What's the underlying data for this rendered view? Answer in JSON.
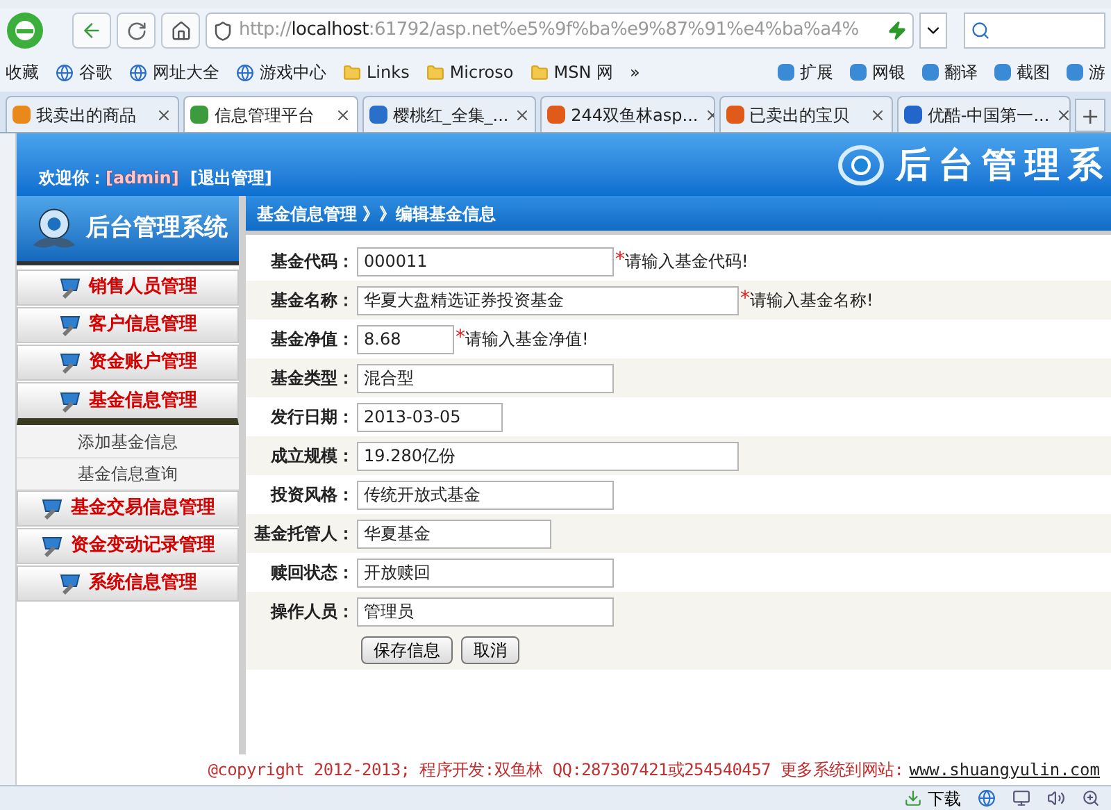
{
  "browser": {
    "url": {
      "scheme": "http://",
      "host": "localhost",
      "rest": ":61792/asp.net%e5%9f%ba%e9%87%91%e4%ba%a4%"
    },
    "bookmarks": [
      {
        "label": "收藏",
        "kind": "menu"
      },
      {
        "label": "谷歌",
        "kind": "site"
      },
      {
        "label": "网址大全",
        "kind": "site"
      },
      {
        "label": "游戏中心",
        "kind": "site"
      },
      {
        "label": "Links",
        "kind": "folder"
      },
      {
        "label": "Microso",
        "kind": "folder"
      },
      {
        "label": "MSN 网",
        "kind": "folder"
      },
      {
        "label": "»",
        "kind": "more"
      }
    ],
    "tools": [
      {
        "label": "扩展"
      },
      {
        "label": "网银"
      },
      {
        "label": "翻译"
      },
      {
        "label": "截图"
      },
      {
        "label": "游"
      }
    ],
    "tabs": [
      {
        "label": "我卖出的商品",
        "selected": false
      },
      {
        "label": "信息管理平台",
        "selected": true
      },
      {
        "label": "樱桃红_全集_...",
        "selected": false
      },
      {
        "label": "244双鱼林asp...",
        "selected": false
      },
      {
        "label": "已卖出的宝贝",
        "selected": false
      },
      {
        "label": "优酷-中国第一...",
        "selected": false
      }
    ],
    "new_tab": "+",
    "status_bar": {
      "download": "下载"
    }
  },
  "header": {
    "welcome": "欢迎你：",
    "user": "[admin]",
    "logout": "[退出管理]",
    "title": "后台管理系"
  },
  "sidebar": {
    "logo": "后台管理系统",
    "items": [
      {
        "label": "销售人员管理",
        "expanded": false
      },
      {
        "label": "客户信息管理",
        "expanded": false
      },
      {
        "label": "资金账户管理",
        "expanded": false
      },
      {
        "label": "基金信息管理",
        "expanded": true,
        "children": [
          {
            "label": "添加基金信息"
          },
          {
            "label": "基金信息查询"
          }
        ]
      },
      {
        "label": "基金交易信息管理",
        "expanded": false
      },
      {
        "label": "资金变动记录管理",
        "expanded": false
      },
      {
        "label": "系统信息管理",
        "expanded": false
      }
    ]
  },
  "breadcrumb": "基金信息管理 》》编辑基金信息",
  "form": {
    "fields": [
      {
        "label": "基金代码：",
        "value": "000011",
        "marker": "*",
        "hint": "请输入基金代码!"
      },
      {
        "label": "基金名称：",
        "value": "华夏大盘精选证券投资基金",
        "marker": "*",
        "hint": "请输入基金名称!"
      },
      {
        "label": "基金净值：",
        "value": "8.68",
        "marker": "*",
        "hint": "请输入基金净值!"
      },
      {
        "label": "基金类型：",
        "value": "混合型"
      },
      {
        "label": "发行日期：",
        "value": "2013-03-05"
      },
      {
        "label": "成立规模：",
        "value": "19.280亿份"
      },
      {
        "label": "投资风格：",
        "value": "传统开放式基金"
      },
      {
        "label": "基金托管人：",
        "value": "华夏基金"
      },
      {
        "label": "赎回状态：",
        "value": "开放赎回"
      },
      {
        "label": "操作人员：",
        "value": "管理员"
      }
    ],
    "buttons": [
      "保存信息",
      "取消"
    ]
  },
  "footer": {
    "text": "@copyright 2012-2013; 程序开发:双鱼林  QQ:287307421或254540457  更多系统到网站:",
    "link": "www.shuangyulin.com"
  }
}
